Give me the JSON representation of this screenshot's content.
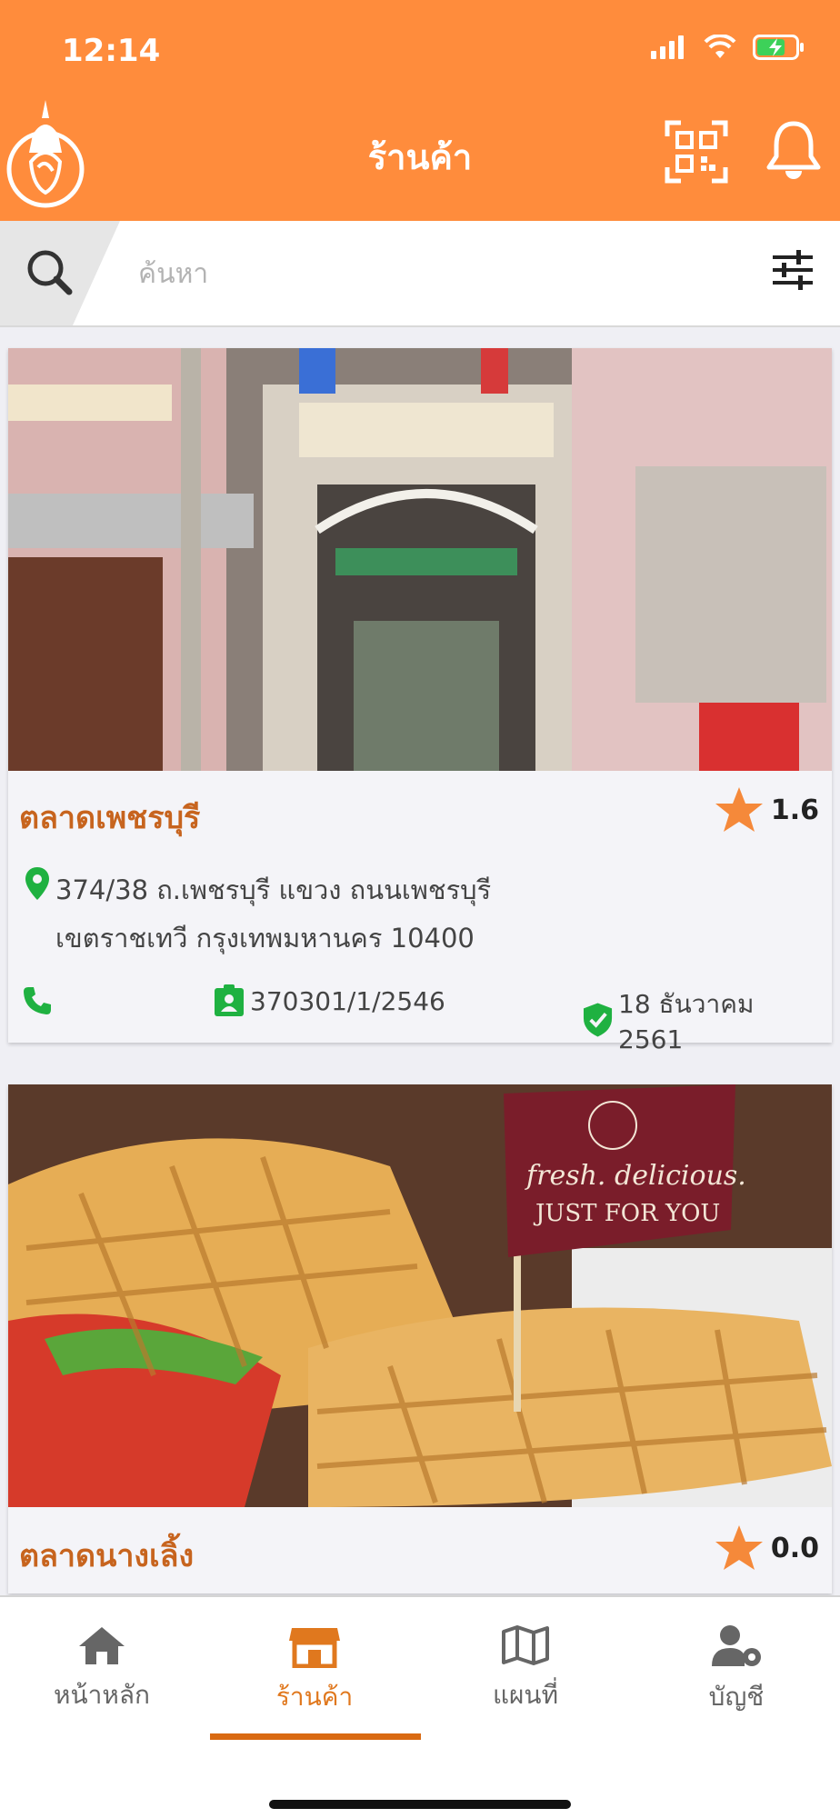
{
  "status": {
    "time": "12:14"
  },
  "header": {
    "title": "ร้านค้า",
    "logo_icon": "food-safety-logo",
    "qr_icon": "qr-code-icon",
    "bell_icon": "bell-icon"
  },
  "search": {
    "placeholder": "ค้นหา",
    "value": ""
  },
  "shops": [
    {
      "name": "ตลาดเพชรบุรี",
      "rating": "1.6",
      "address_line1": "374/38 ถ.เพชรบุรี แขวง ถนนเพชรบุรี",
      "address_line2": "เขตราชเทวี กรุงเทพมหานคร 10400",
      "license": "370301/1/2546",
      "date": "18 ธันวาคม 2561"
    },
    {
      "name": "ตลาดนางเลิ้ง",
      "rating": "0.0"
    }
  ],
  "tabs": [
    {
      "label": "หน้าหลัก",
      "icon": "home-icon"
    },
    {
      "label": "ร้านค้า",
      "icon": "store-icon",
      "active": true
    },
    {
      "label": "แผนที่",
      "icon": "map-icon"
    },
    {
      "label": "บัญชี",
      "icon": "account-settings-icon"
    }
  ],
  "colors": {
    "header": "#ff8c3c",
    "accent": "#d96a12",
    "shop_name": "#c7641e",
    "green": "#1fb141",
    "star": "#f5893a"
  }
}
